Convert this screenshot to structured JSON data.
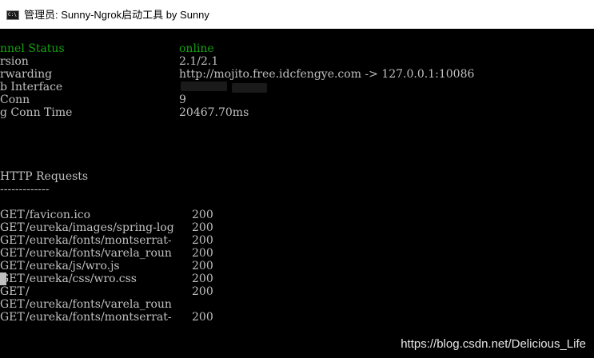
{
  "window": {
    "icon_text": "C:\\",
    "title": "管理员:  Sunny-Ngrok启动工具 by Sunny"
  },
  "status": [
    {
      "label": "nnel Status",
      "value": "online"
    },
    {
      "label": "rsion",
      "value": "2.1/2.1"
    },
    {
      "label": "rwarding",
      "value": "http://mojito.free.idcfengye.com -> 127.0.0.1:10086"
    },
    {
      "label": "b Interface",
      "value": ""
    },
    {
      "label": "Conn",
      "value": "9"
    },
    {
      "label": "g Conn Time",
      "value": "20467.70ms"
    }
  ],
  "requests": {
    "title": "HTTP Requests",
    "separator": "-------------",
    "rows": [
      {
        "method": "GET",
        "path": "/favicon.ico",
        "code": "200"
      },
      {
        "method": "GET",
        "path": "/eureka/images/spring-log",
        "code": "200"
      },
      {
        "method": "GET",
        "path": "/eureka/fonts/montserrat-",
        "code": "200"
      },
      {
        "method": "GET",
        "path": "/eureka/fonts/varela_roun",
        "code": "200"
      },
      {
        "method": "GET",
        "path": "/eureka/js/wro.js",
        "code": "200"
      },
      {
        "method": "GET",
        "path": "/eureka/css/wro.css",
        "code": "200"
      },
      {
        "method": "GET",
        "path": "/",
        "code": "200"
      },
      {
        "method": "GET",
        "path": "/eureka/fonts/varela_roun",
        "code": ""
      },
      {
        "method": "GET",
        "path": "/eureka/fonts/montserrat-",
        "code": "200"
      }
    ]
  },
  "watermark": "https://blog.csdn.net/Delicious_Life",
  "colors": {
    "status_green": "#13a10e",
    "text": "#c0c0c0",
    "background": "#000000"
  }
}
